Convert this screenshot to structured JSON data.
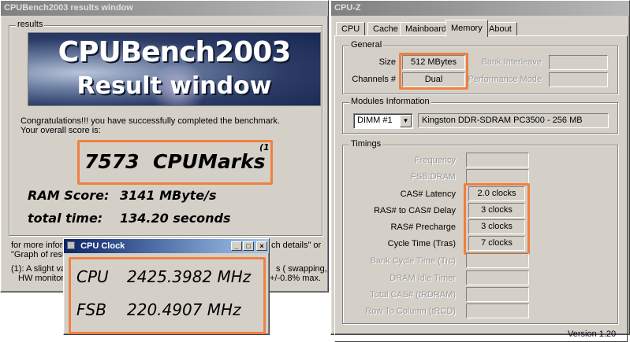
{
  "cpubench": {
    "title": "CPUBench2003  results window",
    "group_label": "results",
    "banner_line1": "CPUBench2003",
    "banner_line2": "Result window",
    "congrats": "Congratulations!!! you have successfully completed the benchmark.",
    "overall_intro": "Your overall score is:",
    "score": "7573  CPUMarks",
    "score_note": "(1",
    "ram_label": "RAM Score:",
    "ram_value": "3141 MByte/s",
    "time_label": "total time:",
    "time_value": "134.20 seconds",
    "more_info_left": "for more inform",
    "more_info_right": "ch details\" or",
    "graph_left": "\"Graph of resu",
    "note1_left": "(1): A slight va",
    "note1_right": "s ( swapping,",
    "note2_left": "HW monitorin",
    "note2_right": "+/-0.8% max."
  },
  "cpuclock": {
    "title": "CPU Clock",
    "cpu_label": "CPU",
    "cpu_value": "2425.3982 MHz",
    "fsb_label": "FSB",
    "fsb_value": "220.4907 MHz",
    "btn_min": "_",
    "btn_max": "□",
    "btn_close": "×"
  },
  "cpuz": {
    "title": "CPU-Z",
    "tabs": [
      "CPU",
      "Cache",
      "Mainboard",
      "Memory",
      "About"
    ],
    "active_tab": "Memory",
    "general": {
      "label": "General",
      "size_label": "Size",
      "size_value": "512 MBytes",
      "channels_label": "Channels #",
      "channels_value": "Dual",
      "bank_label": "Bank Interleave",
      "perf_label": "Performance Mode"
    },
    "modules": {
      "label": "Modules Information",
      "slot": "DIMM #1",
      "desc": "Kingston DDR-SDRAM PC3500 - 256 MB"
    },
    "timings": {
      "label": "Timings",
      "frequency": "Frequency",
      "fsb_dram": "FSB:DRAM",
      "cas_label": "CAS# Latency",
      "cas_value": "2.0 clocks",
      "rcd_label": "RAS# to CAS# Delay",
      "rcd_value": "3 clocks",
      "rp_label": "RAS# Precharge",
      "rp_value": "3 clocks",
      "tras_label": "Cycle Time (Tras)",
      "tras_value": "7 clocks",
      "trc_label": "Bank Cycle Time (Trc)",
      "idle_label": "DRAM Idle Timer",
      "total_cas_label": "Total CAS# (tRDRAM)",
      "trcd_label": "Row To Column (tRCD)"
    },
    "version": "Version 1.20"
  },
  "colors": {
    "highlight": "#f08040",
    "window_face": "#d4d0c8",
    "title_active": "#0a246a"
  }
}
